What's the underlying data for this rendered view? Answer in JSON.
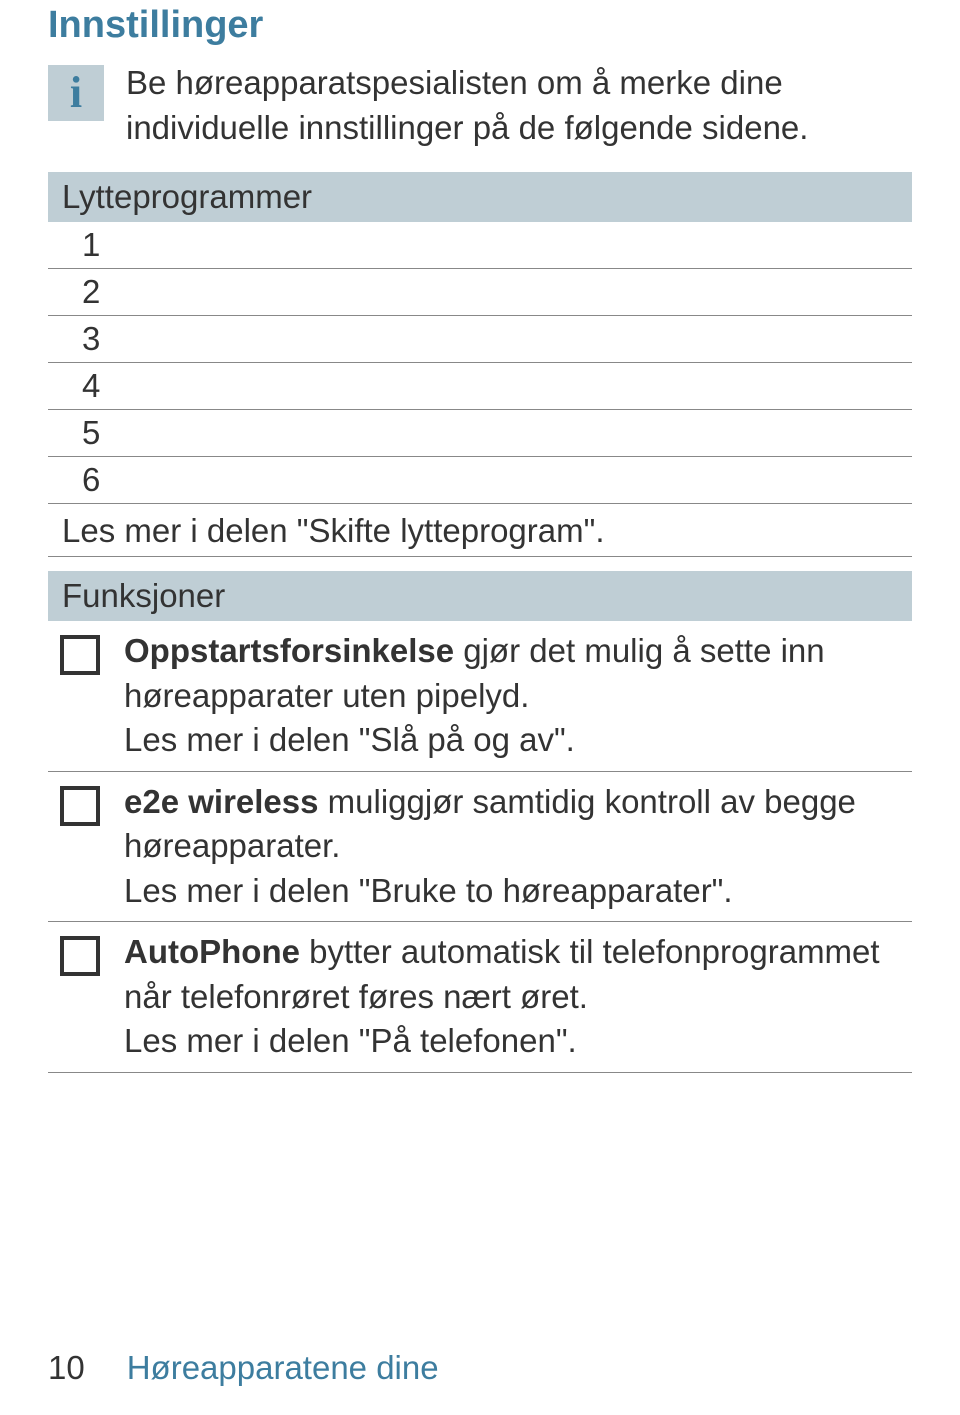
{
  "title": "Innstillinger",
  "info": {
    "label": "i",
    "text": "Be høreapparatspesialisten om å merke dine individuelle innstillinger på de følgende sidene."
  },
  "sections": {
    "programs": {
      "heading": "Lytteprogrammer",
      "rows": [
        "1",
        "2",
        "3",
        "4",
        "5",
        "6"
      ],
      "note": "Les mer i delen \"Skifte lytteprogram\"."
    },
    "features": {
      "heading": "Funksjoner",
      "items": [
        {
          "bold": "Oppstartsforsinkelse",
          "rest": " gjør det mulig å sette inn høreapparater uten pipelyd.",
          "readmore": "Les mer i delen \"Slå på og av\"."
        },
        {
          "bold": "e2e wireless",
          "rest": " muliggjør samtidig kontroll av begge høreapparater.",
          "readmore": "Les mer i delen \"Bruke to høreapparater\"."
        },
        {
          "bold": "AutoPhone",
          "rest": " bytter automatisk til telefonprogrammet når telefonrøret føres nært øret.",
          "readmore": "Les mer i delen \"På telefonen\"."
        }
      ]
    }
  },
  "footer": {
    "page": "10",
    "section": "Høreapparatene dine"
  }
}
